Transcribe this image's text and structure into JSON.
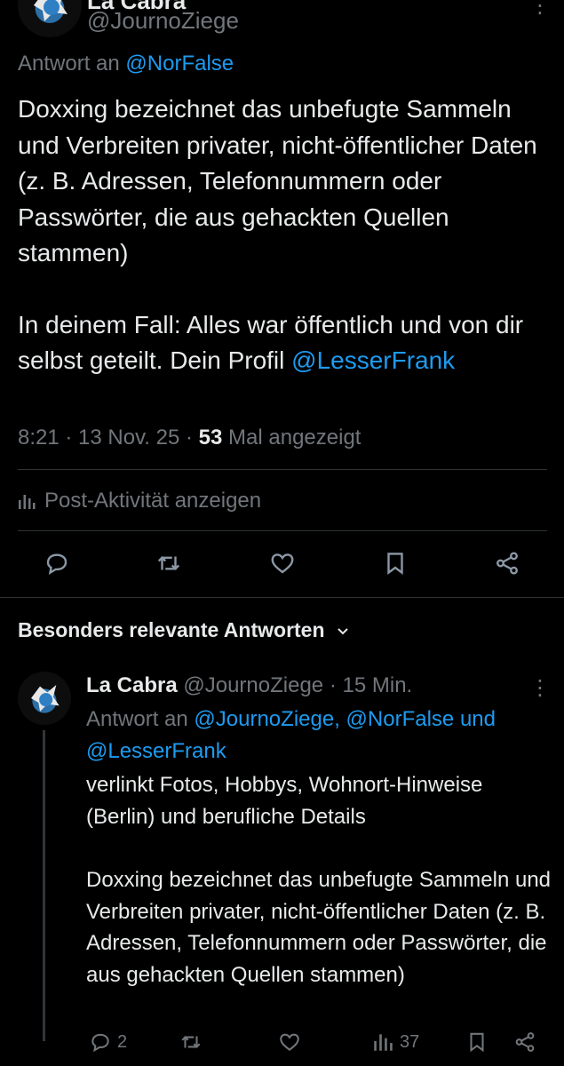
{
  "top_post": {
    "author_name": "La Cabra",
    "handle": "@JournoZiege",
    "reply_label": "Antwort an",
    "reply_to": "@NorFalse",
    "text_p1": "Doxxing bezeichnet das unbefugte Sammeln und Verbreiten privater, nicht-öffentlicher Daten (z. B. Adressen, Telefonnummern oder Passwörter, die aus gehackten Quellen stammen)",
    "text_p2": "In deinem Fall: Alles war öffentlich und von dir selbst geteilt. Dein Profil",
    "text_mention": "@LesserFrank",
    "time": "8:21 · 13 Nov. 25 · ",
    "views_count": "53",
    "views_label": " Mal angezeigt",
    "activity_label": "Post-Aktivität anzeigen"
  },
  "section": {
    "title": "Besonders relevante Antworten"
  },
  "reply_post": {
    "author_name": "La Cabra",
    "handle": "@JournoZiege",
    "time": "15 Min.",
    "reply_label": "Antwort an",
    "reply_to_1": "@JournoZiege,",
    "reply_to_2": "@NorFalse",
    "reply_and": "und",
    "reply_to_3": "@LesserFrank",
    "text_p1": "verlinkt Fotos, Hobbys, Wohnort-Hinweise (Berlin) und berufliche Details",
    "text_p2": "Doxxing bezeichnet das unbefugte Sammeln und Verbreiten privater, nicht-öffentlicher Daten (z. B. Adressen, Telefonnummern oder Passwörter, die aus gehackten Quellen stammen)",
    "reply_count": "2",
    "views_count": "37"
  },
  "icons": {
    "reply": "reply-icon",
    "repost": "repost-icon",
    "like": "heart-icon",
    "bookmark": "bookmark-icon",
    "share": "share-icon",
    "stats": "stats-icon",
    "more": "more-icon",
    "chevron": "chevron-down-icon"
  },
  "colors": {
    "background": "#000000",
    "text": "#e7e9ea",
    "secondary": "#71767b",
    "link": "#1d9bf0",
    "divider": "#2f3336"
  }
}
